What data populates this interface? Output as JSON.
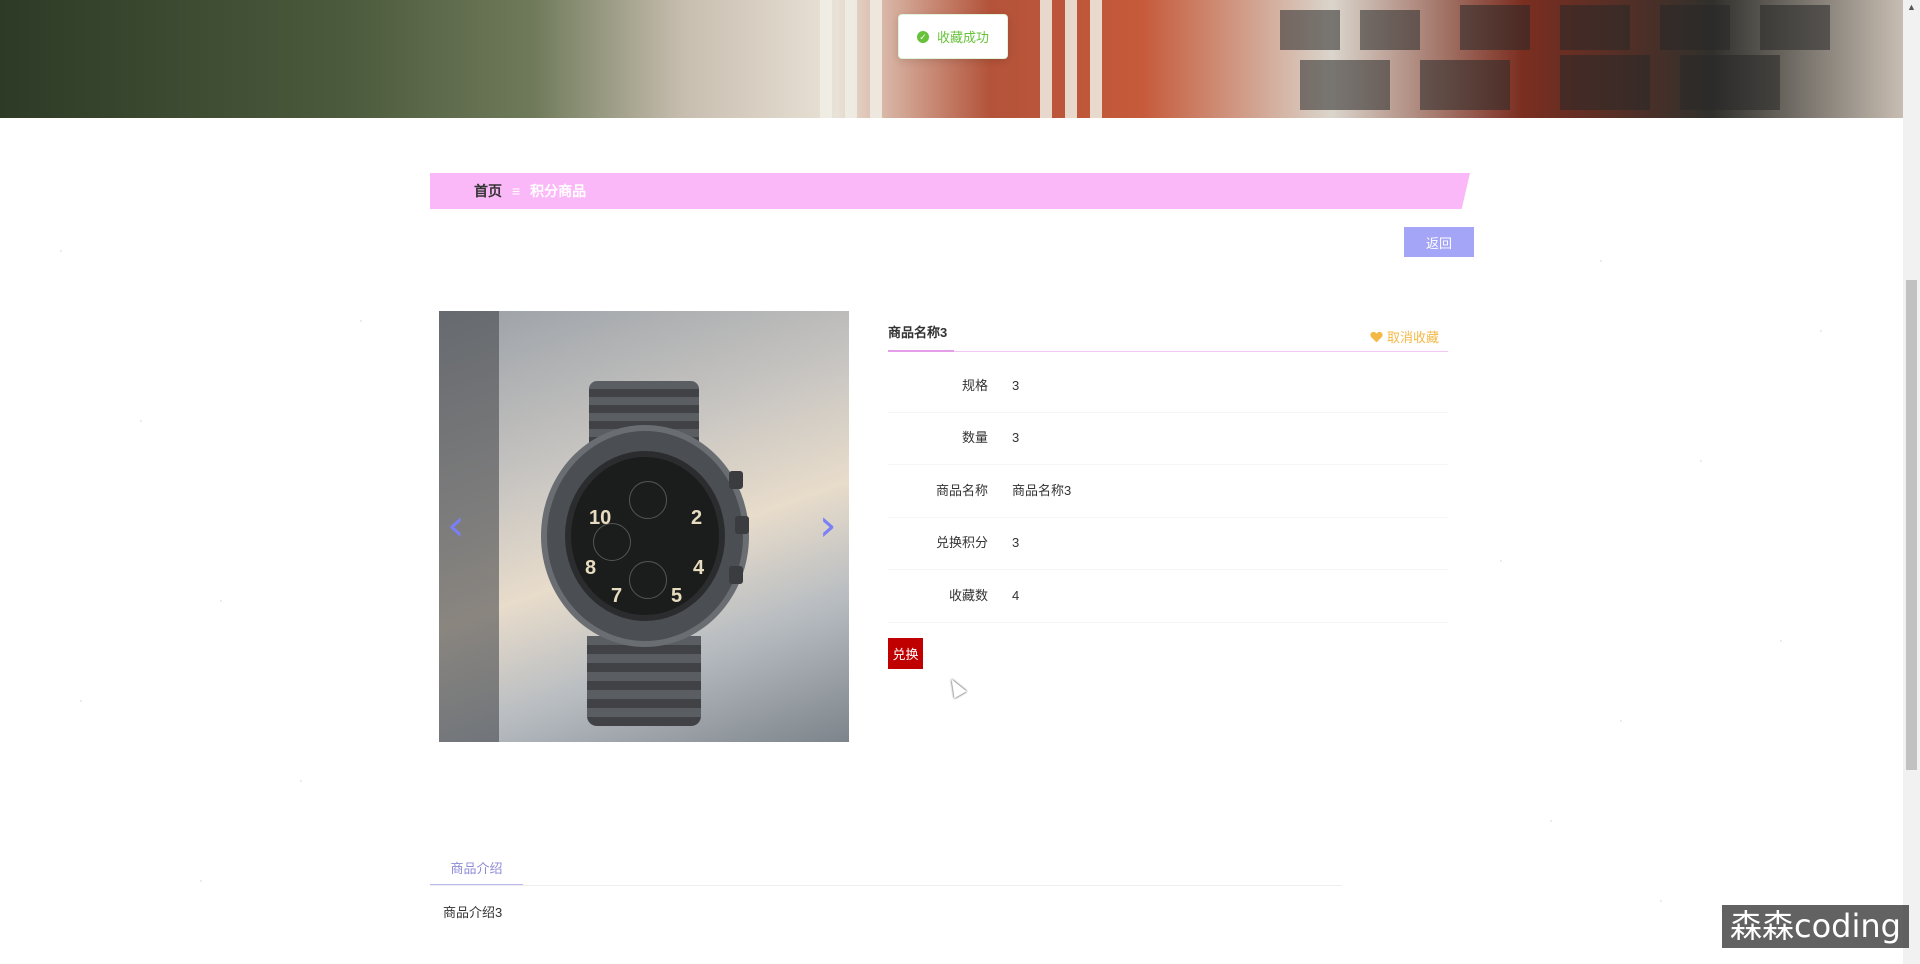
{
  "toast": {
    "message": "收藏成功",
    "icon": "check-circle-icon",
    "color": "#67c23a"
  },
  "breadcrumb": {
    "home": "首页",
    "separator": "≡",
    "current": "积分商品",
    "background": "#fbb8f8"
  },
  "toolbar": {
    "back_label": "返回",
    "back_color": "#a5a5f7"
  },
  "carousel": {
    "prev_icon": "chevron-left-icon",
    "next_icon": "chevron-right-icon",
    "watch_numbers": [
      "10",
      "2",
      "4",
      "5",
      "7",
      "8"
    ]
  },
  "product": {
    "title": "商品名称3",
    "favorite_label": "取消收藏",
    "favorite_icon": "heart-icon",
    "favorite_color": "#f4b846",
    "fields": [
      {
        "label": "规格",
        "value": "3"
      },
      {
        "label": "数量",
        "value": "3"
      },
      {
        "label": "商品名称",
        "value": "商品名称3"
      },
      {
        "label": "兑换积分",
        "value": "3"
      },
      {
        "label": "收藏数",
        "value": "4"
      }
    ],
    "exchange_label": "兑换",
    "exchange_color": "#c00000"
  },
  "tabs": [
    {
      "label": "商品介绍"
    }
  ],
  "tab_content": "商品介绍3",
  "watermark": "森森coding"
}
